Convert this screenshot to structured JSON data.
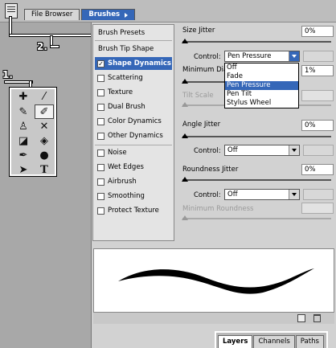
{
  "tabs": [
    {
      "label": "File Browser",
      "active": false
    },
    {
      "label": "Brushes",
      "active": true
    }
  ],
  "callouts": {
    "one": "1.",
    "two": "2."
  },
  "tools": [
    "move-icon",
    "magic-wand-icon",
    "bandaid-icon",
    "brush-icon",
    "stamp-icon",
    "history-brush-icon",
    "eraser-icon",
    "paint-bucket-icon",
    "pen-icon",
    "dodge-icon",
    "path-select-icon",
    "type-icon"
  ],
  "brush_options": {
    "presets": "Brush Presets",
    "tip_shape": "Brush Tip Shape",
    "items": [
      {
        "label": "Shape Dynamics",
        "checked": true,
        "selected": true
      },
      {
        "label": "Scattering",
        "checked": false
      },
      {
        "label": "Texture",
        "checked": false
      },
      {
        "label": "Dual Brush",
        "checked": false
      },
      {
        "label": "Color Dynamics",
        "checked": false
      },
      {
        "label": "Other Dynamics",
        "checked": false
      }
    ],
    "extras": [
      {
        "label": "Noise",
        "checked": false
      },
      {
        "label": "Wet Edges",
        "checked": false
      },
      {
        "label": "Airbrush",
        "checked": false
      },
      {
        "label": "Smoothing",
        "checked": false
      },
      {
        "label": "Protect Texture",
        "checked": false
      }
    ]
  },
  "settings": {
    "size_jitter": {
      "label": "Size Jitter",
      "value": "0%"
    },
    "size_control": {
      "label": "Control:",
      "value": "Pen Pressure"
    },
    "min_diameter": {
      "label": "Minimum Diam",
      "value": "1%"
    },
    "tilt_scale": {
      "label": "Tilt Scale"
    },
    "angle_jitter": {
      "label": "Angle Jitter",
      "value": "0%"
    },
    "angle_control": {
      "label": "Control:",
      "value": "Off"
    },
    "roundness_jitter": {
      "label": "Roundness Jitter",
      "value": "0%"
    },
    "roundness_control": {
      "label": "Control:",
      "value": "Off"
    },
    "min_roundness": {
      "label": "Minimum Roundness"
    }
  },
  "dropdown_options": [
    "Off",
    "Fade",
    "Pen Pressure",
    "Pen Tilt",
    "Stylus Wheel"
  ],
  "dropdown_selected": "Pen Pressure",
  "bottom_tabs": [
    {
      "label": "Layers",
      "active": true
    },
    {
      "label": "Channels",
      "active": false
    },
    {
      "label": "Paths",
      "active": false
    }
  ],
  "colors": {
    "accent": "#3567b8"
  }
}
